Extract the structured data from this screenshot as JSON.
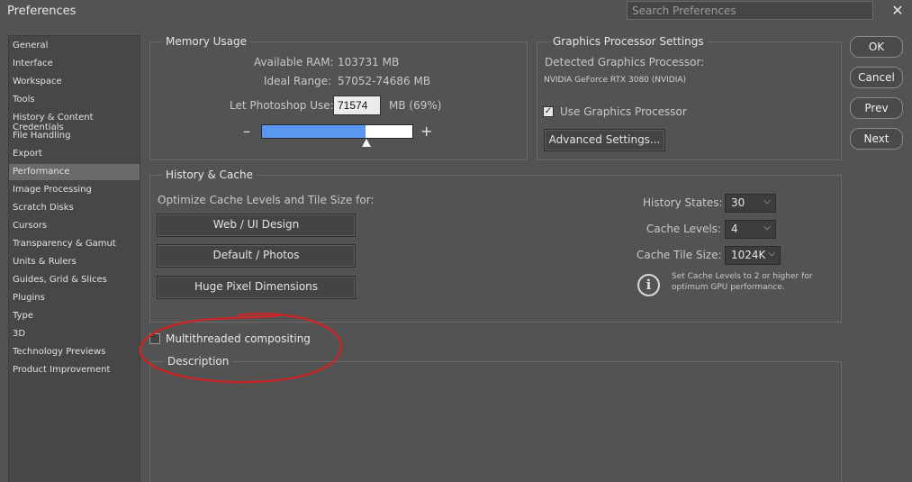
{
  "window": {
    "title": "Preferences",
    "close_glyph": "✕"
  },
  "search": {
    "placeholder": "Search Preferences"
  },
  "sidebar": {
    "items": [
      {
        "label": "General"
      },
      {
        "label": "Interface"
      },
      {
        "label": "Workspace"
      },
      {
        "label": "Tools"
      },
      {
        "label": "History & Content Credentials"
      },
      {
        "label": "File Handling"
      },
      {
        "label": "Export"
      },
      {
        "label": "Performance",
        "selected": true
      },
      {
        "label": "Image Processing"
      },
      {
        "label": "Scratch Disks"
      },
      {
        "label": "Cursors"
      },
      {
        "label": "Transparency & Gamut"
      },
      {
        "label": "Units & Rulers"
      },
      {
        "label": "Guides, Grid & Slices"
      },
      {
        "label": "Plugins"
      },
      {
        "label": "Type"
      },
      {
        "label": "3D"
      },
      {
        "label": "Technology Previews"
      },
      {
        "label": "Product Improvement"
      }
    ]
  },
  "memory": {
    "legend": "Memory Usage",
    "available_label": "Available RAM:",
    "available_value": "103731 MB",
    "ideal_label": "Ideal Range:",
    "ideal_value": "57052-74686 MB",
    "use_label": "Let Photoshop Use:",
    "use_value": "71574",
    "use_suffix": "MB (69%)",
    "minus": "–",
    "plus": "+",
    "slider_fraction": 0.69
  },
  "gpu": {
    "legend": "Graphics Processor Settings",
    "detected_label": "Detected Graphics Processor:",
    "gpu_name": "NVIDIA GeForce RTX 3080 (NVIDIA)",
    "use_gpu_label": "Use Graphics Processor",
    "use_gpu_checked": true,
    "advanced_label": "Advanced Settings..."
  },
  "history": {
    "legend": "History & Cache",
    "optimize_label": "Optimize Cache Levels and Tile Size for:",
    "btn_web": "Web / UI Design",
    "btn_default": "Default / Photos",
    "btn_huge": "Huge Pixel Dimensions",
    "states_label": "History States:",
    "states_value": "30",
    "levels_label": "Cache Levels:",
    "levels_value": "4",
    "tile_label": "Cache Tile Size:",
    "tile_value": "1024K",
    "info_text_1": "Set Cache Levels to 2 or higher for",
    "info_text_2": "optimum GPU performance."
  },
  "multithread": {
    "label": "Multithreaded compositing",
    "checked": false
  },
  "description": {
    "legend": "Description"
  },
  "buttons": {
    "ok": "OK",
    "cancel": "Cancel",
    "prev": "Prev",
    "next": "Next"
  },
  "colors": {
    "slider_fill": "#5b96f0",
    "annotation": "#c42828",
    "background": "#535353"
  }
}
